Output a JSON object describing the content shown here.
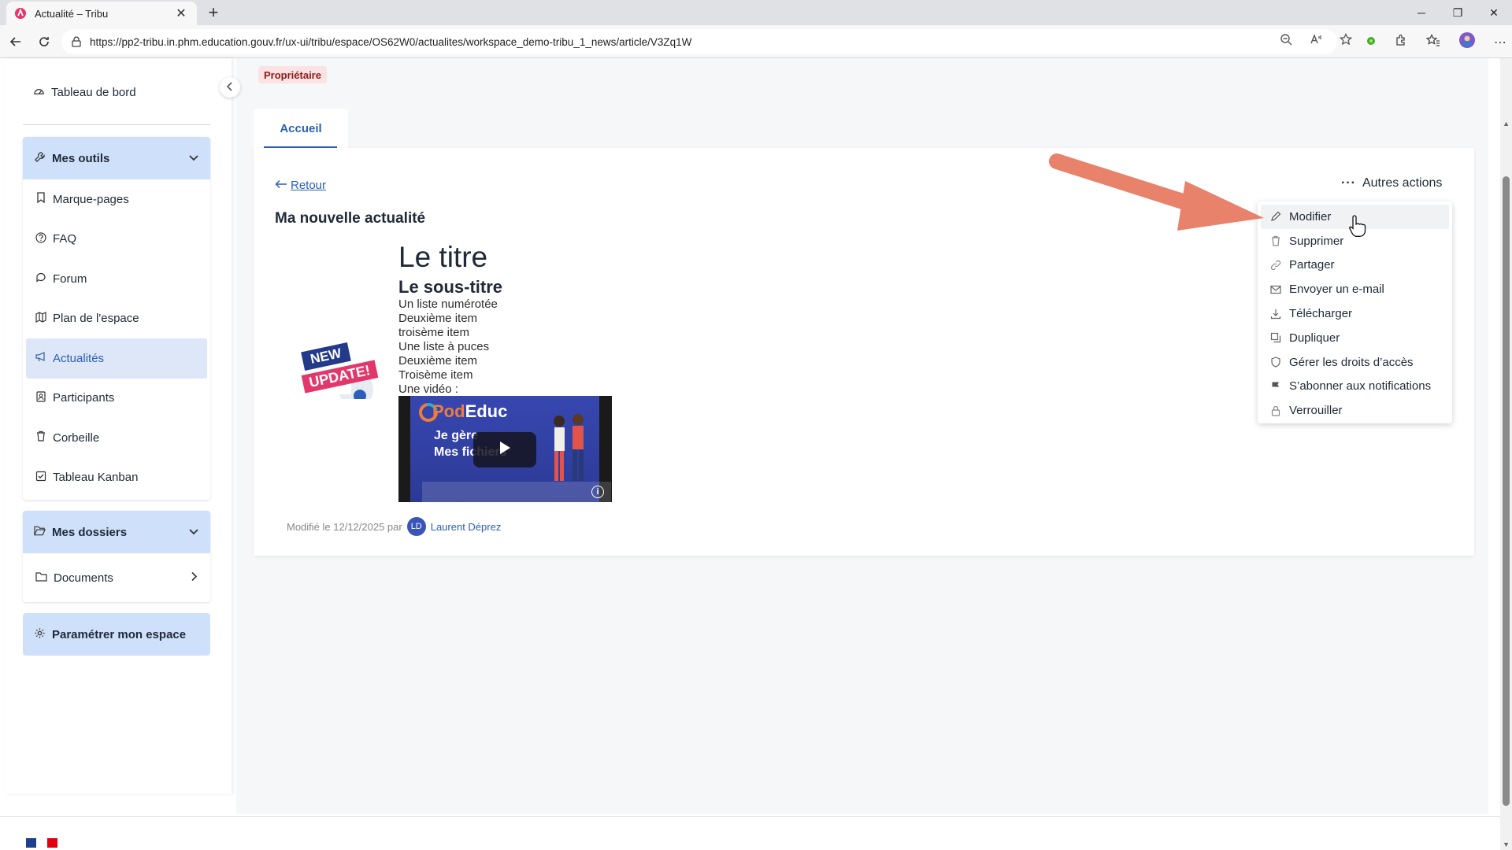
{
  "browser": {
    "tab_title": "Actualité – Tribu",
    "url": "https://pp2-tribu.in.phm.education.gouv.fr/ux-ui/tribu/espace/OS62W0/actualites/workspace_demo-tribu_1_news/article/V3Zq1W"
  },
  "sidebar": {
    "dashboard": "Tableau de bord",
    "tools_header": "Mes outils",
    "tools": [
      {
        "label": "Marque-pages",
        "icon": "bookmark-icon"
      },
      {
        "label": "FAQ",
        "icon": "question-icon"
      },
      {
        "label": "Forum",
        "icon": "forum-icon"
      },
      {
        "label": "Plan de l'espace",
        "icon": "map-icon"
      },
      {
        "label": "Actualités",
        "icon": "megaphone-icon",
        "active": true
      },
      {
        "label": "Participants",
        "icon": "participants-icon"
      },
      {
        "label": "Corbeille",
        "icon": "trash-icon"
      },
      {
        "label": "Tableau Kanban",
        "icon": "kanban-icon"
      }
    ],
    "folders_header": "Mes dossiers",
    "documents": "Documents",
    "settings": "Paramétrer mon espace"
  },
  "main": {
    "role_badge": "Propriétaire",
    "tab": "Accueil",
    "back": "Retour",
    "title": "Ma nouvelle actualité",
    "more_actions": "Autres actions",
    "body": {
      "h1": "Le titre",
      "h2": "Le sous-titre",
      "lines": [
        "Un liste numérotée",
        "Deuxième item",
        "troisème item",
        "Une liste à puces",
        "Deuxième item",
        "Troisème item",
        "Une vidéo :"
      ]
    },
    "image_text": {
      "line1": "NEW",
      "line2": "UPDATE!"
    },
    "video": {
      "brand_pod": "Pod",
      "brand_educ": "Educ",
      "text_line1": "Je gère",
      "text_line2": "Mes fichiers"
    },
    "modified_prefix": "Modifié le 12/12/2025 par",
    "author_initials": "LD",
    "author": "Laurent Déprez"
  },
  "dropdown": {
    "items": [
      {
        "label": "Modifier",
        "icon": "pencil-icon"
      },
      {
        "label": "Supprimer",
        "icon": "trash-icon"
      },
      {
        "label": "Partager",
        "icon": "link-icon"
      },
      {
        "label": "Envoyer un e-mail",
        "icon": "mail-icon"
      },
      {
        "label": "Télécharger",
        "icon": "download-icon"
      },
      {
        "label": "Dupliquer",
        "icon": "duplicate-icon"
      },
      {
        "label": "Gérer les droits d’accès",
        "icon": "shield-icon"
      },
      {
        "label": "S’abonner aux notifications",
        "icon": "flag-icon"
      },
      {
        "label": "Verrouiller",
        "icon": "lock-icon"
      }
    ]
  },
  "colors": {
    "accent": "#2b5fb5",
    "sidebar_header_bg": "#cfe0fa",
    "arrow": "#e8826b"
  }
}
